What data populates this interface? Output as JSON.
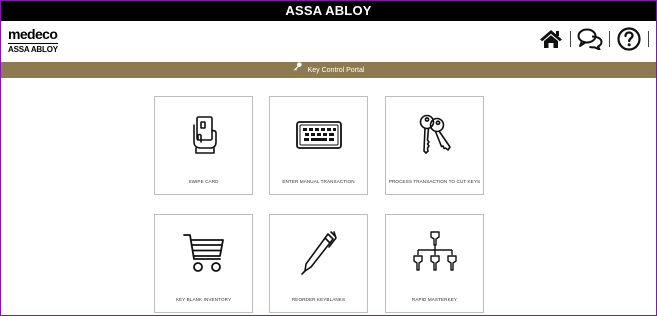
{
  "topbar": {
    "title": "ASSA ABLOY"
  },
  "brand": {
    "line1": "medeco",
    "line2": "ASSA ABLOY"
  },
  "header_icons": [
    "home-icon",
    "chat-icon",
    "help-icon"
  ],
  "banner": {
    "icon": "key-icon",
    "title": "Key Control Portal"
  },
  "tiles": [
    {
      "label": "SWIPE CARD",
      "icon": "card-swipe-icon"
    },
    {
      "label": "ENTER MANUAL TRANSACTION",
      "icon": "keyboard-icon"
    },
    {
      "label": "PROCESS TRANSACTION TO CUT KEYS",
      "icon": "keys-icon"
    },
    {
      "label": "KEY BLANK INVENTORY",
      "icon": "cart-icon"
    },
    {
      "label": "REORDER KEYBLANKS",
      "icon": "pen-icon"
    },
    {
      "label": "RAPID MASTERKEY",
      "icon": "key-hierarchy-icon"
    }
  ],
  "colors": {
    "topbar": "#000000",
    "banner": "#8e7a50",
    "frame": "#7a1fa2",
    "tile_border": "#bdbdbd"
  }
}
